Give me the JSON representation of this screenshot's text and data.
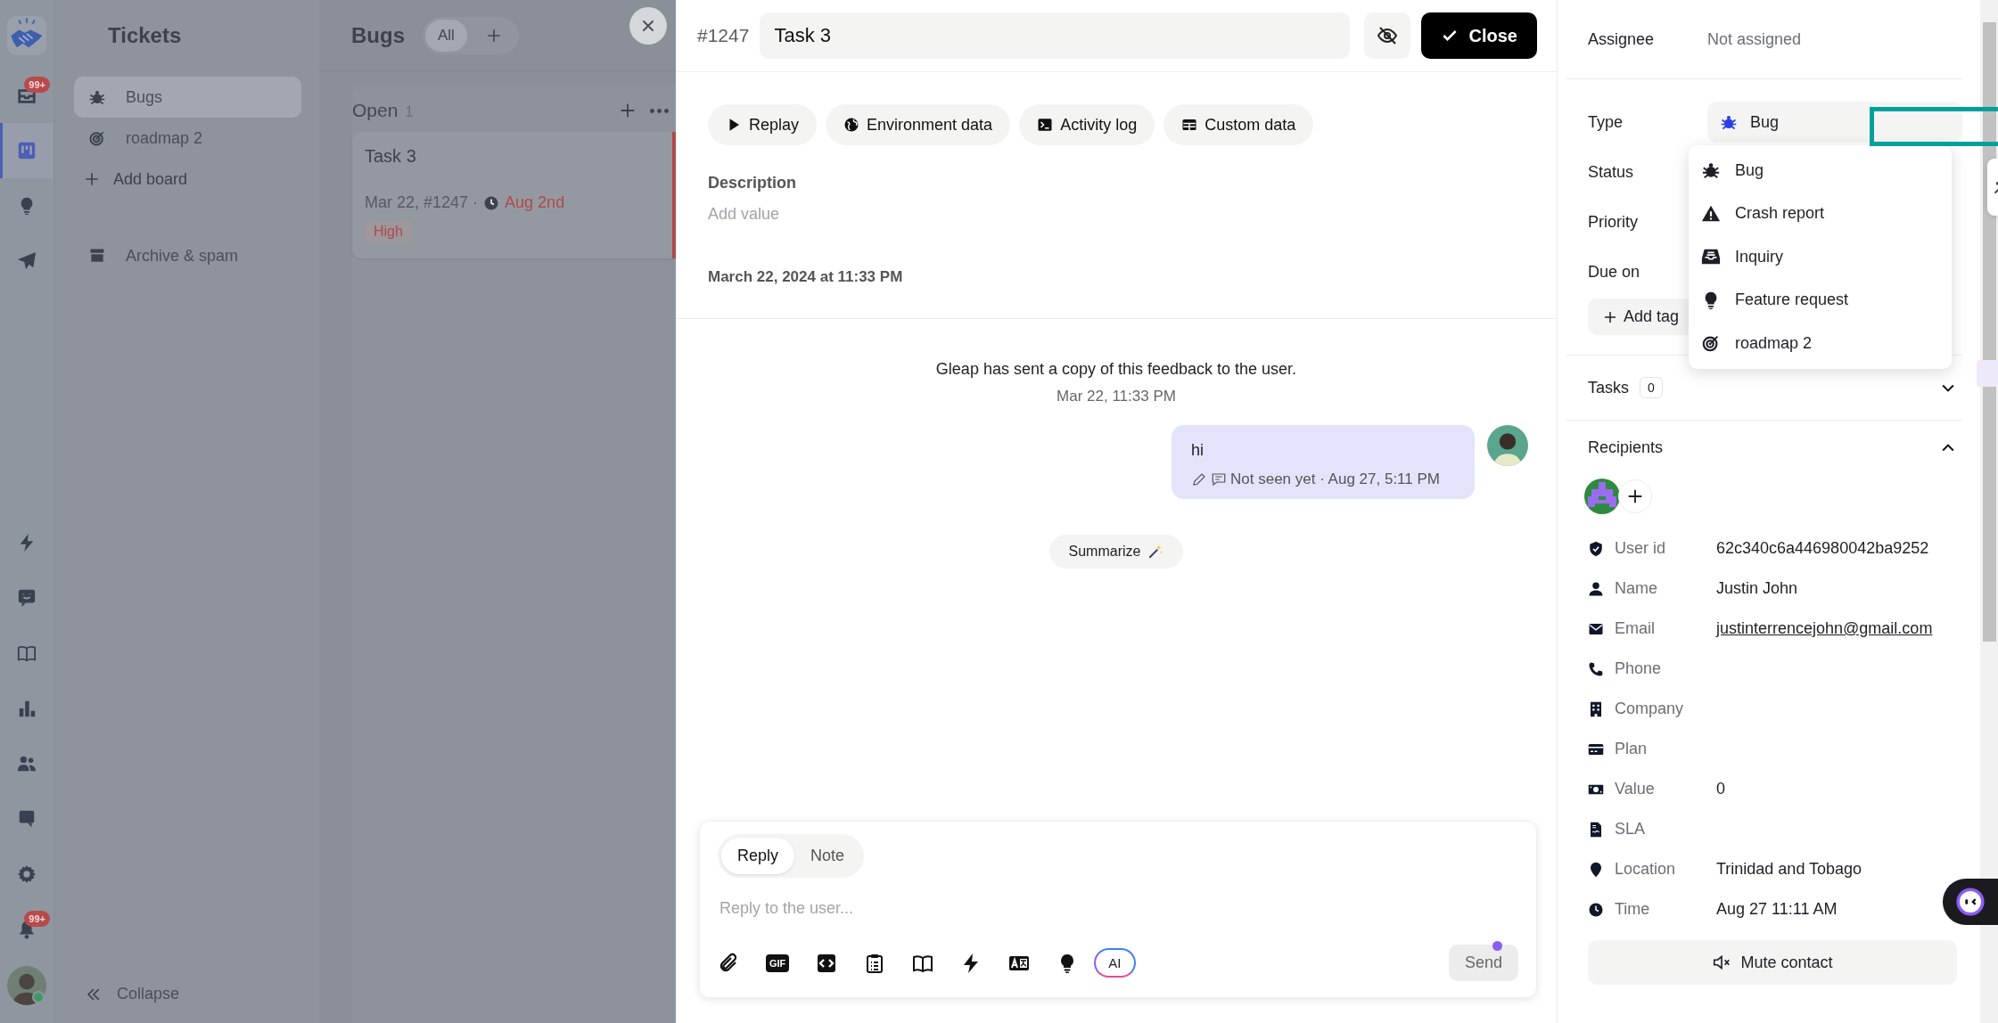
{
  "rail": {
    "top": [
      {
        "selected": false,
        "badge": "99+"
      },
      {
        "selected": true
      },
      {
        "selected": false
      },
      {
        "selected": false
      }
    ],
    "bottom": [
      {
        "selected": false
      },
      {
        "selected": false
      },
      {
        "selected": false
      },
      {
        "selected": false
      },
      {
        "selected": false
      },
      {
        "selected": false
      },
      {
        "selected": false
      },
      {
        "selected": false,
        "badge": "99+"
      }
    ]
  },
  "sidebar": {
    "title": "Tickets",
    "boards": [
      {
        "label": "Bugs",
        "selected": true
      },
      {
        "label": "roadmap 2",
        "selected": false
      }
    ],
    "add_board": "Add board",
    "archive": "Archive & spam",
    "collapse": "Collapse"
  },
  "board": {
    "title": "Bugs",
    "filters": [
      {
        "label": "All",
        "selected": true
      }
    ],
    "column": {
      "title": "Open",
      "count": "1",
      "cards": [
        {
          "title": "Task 3",
          "meta": "Mar 22, #1247 ·",
          "due": "Aug 2nd",
          "overdue": true,
          "priority": "High",
          "selected": true
        }
      ]
    }
  },
  "ticket": {
    "number": "#1247",
    "title": "Task 3",
    "close": "Close",
    "actions": [
      {
        "label": "Replay"
      },
      {
        "label": "Environment data"
      },
      {
        "label": "Activity log"
      },
      {
        "label": "Custom data"
      }
    ],
    "description_label": "Description",
    "description_placeholder": "Add value",
    "created": "March 22, 2024 at 11:33 PM"
  },
  "conversation": {
    "system_message": "Gleap has sent a copy of this feedback to the user.",
    "system_time": "Mar 22, 11:33 PM",
    "messages": [
      {
        "text": "hi",
        "status": "Not seen yet · Aug 27, 5:11 PM"
      }
    ],
    "summarize": "Summarize"
  },
  "composer": {
    "tabs": [
      {
        "label": "Reply",
        "selected": true
      },
      {
        "label": "Note",
        "selected": false
      }
    ],
    "placeholder": "Reply to the user...",
    "gif": "GIF",
    "ai": "AI",
    "send": "Send"
  },
  "details": {
    "assignee_label": "Assignee",
    "assignee": "Not assigned",
    "fields": [
      {
        "label": "Type",
        "value": "Bug"
      },
      {
        "label": "Status"
      },
      {
        "label": "Priority"
      },
      {
        "label": "Due on"
      }
    ],
    "add_tag": "Add tag",
    "type_menu": [
      {
        "label": "Bug",
        "selected": false
      },
      {
        "label": "Crash report",
        "selected": false
      },
      {
        "label": "Inquiry",
        "selected": false
      },
      {
        "label": "Feature request",
        "selected": false
      },
      {
        "label": "roadmap 2",
        "selected": false
      }
    ],
    "tasks": {
      "label": "Tasks",
      "count": "0",
      "expanded": false
    },
    "recipients": {
      "label": "Recipients",
      "expanded": true,
      "attributes": [
        {
          "label": "User id",
          "value": "62c340c6a446980042ba9252"
        },
        {
          "label": "Name",
          "value": "Justin John"
        },
        {
          "label": "Email",
          "value": "justinterrencejohn@gmail.com",
          "kind": "link"
        },
        {
          "label": "Phone"
        },
        {
          "label": "Company"
        },
        {
          "label": "Plan"
        },
        {
          "label": "Value",
          "value": "0"
        },
        {
          "label": "SLA"
        },
        {
          "label": "Location",
          "value": "Trinidad and Tobago"
        },
        {
          "label": "Time",
          "value": "Aug 27 11:11 AM"
        }
      ],
      "mute": "Mute contact"
    }
  }
}
